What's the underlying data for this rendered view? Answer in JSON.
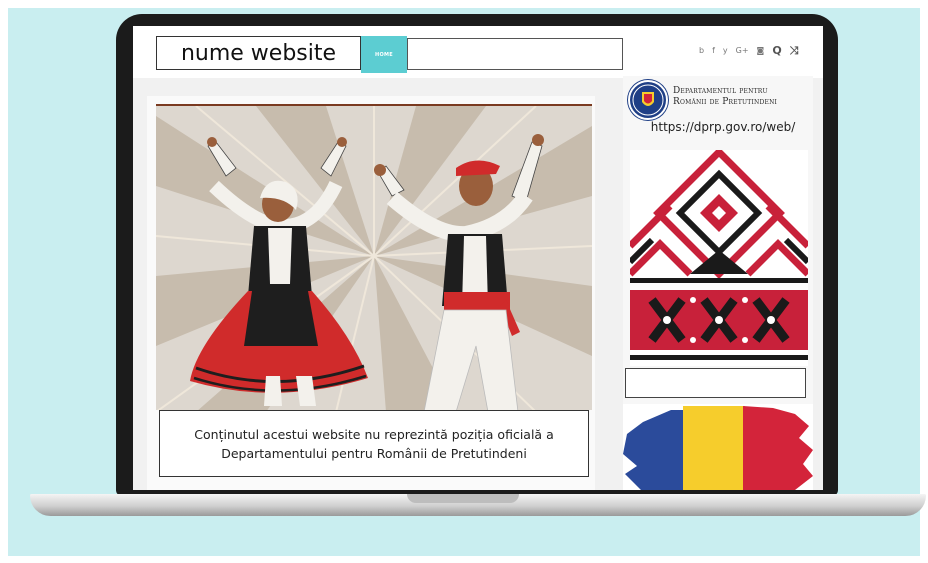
{
  "header": {
    "site_name": "nume website",
    "nav_home": "HOME",
    "search_value": "",
    "social_icons": [
      "behance-icon",
      "facebook-icon",
      "twitter-icon",
      "google-plus-icon",
      "instagram-icon",
      "search-icon",
      "shuffle-icon"
    ],
    "social_glyphs": [
      "b",
      "f",
      "y",
      "G+",
      "◙",
      "Q",
      "⤨"
    ]
  },
  "main": {
    "disclaimer": "Conținutul acestui website nu reprezintă poziția oficială a Departamentului pentru Românii de Pretutindeni"
  },
  "sidebar": {
    "logo_line1": "Departamentul pentru",
    "logo_line2": "Românii de Pretutindeni",
    "url": "https://dprp.gov.ro/web/",
    "input_value": ""
  },
  "colors": {
    "accent": "#5ccdd2",
    "backdrop": "#c9eef0",
    "flag_blue": "#2b4b9b",
    "flag_yellow": "#f6cd2c",
    "flag_red": "#d3243a"
  }
}
